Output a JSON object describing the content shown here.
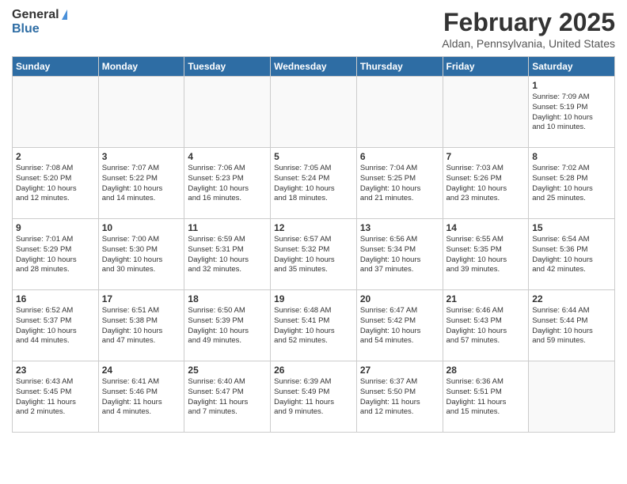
{
  "header": {
    "logo_general": "General",
    "logo_blue": "Blue",
    "title": "February 2025",
    "subtitle": "Aldan, Pennsylvania, United States"
  },
  "weekdays": [
    "Sunday",
    "Monday",
    "Tuesday",
    "Wednesday",
    "Thursday",
    "Friday",
    "Saturday"
  ],
  "weeks": [
    [
      {
        "day": "",
        "info": ""
      },
      {
        "day": "",
        "info": ""
      },
      {
        "day": "",
        "info": ""
      },
      {
        "day": "",
        "info": ""
      },
      {
        "day": "",
        "info": ""
      },
      {
        "day": "",
        "info": ""
      },
      {
        "day": "1",
        "info": "Sunrise: 7:09 AM\nSunset: 5:19 PM\nDaylight: 10 hours\nand 10 minutes."
      }
    ],
    [
      {
        "day": "2",
        "info": "Sunrise: 7:08 AM\nSunset: 5:20 PM\nDaylight: 10 hours\nand 12 minutes."
      },
      {
        "day": "3",
        "info": "Sunrise: 7:07 AM\nSunset: 5:22 PM\nDaylight: 10 hours\nand 14 minutes."
      },
      {
        "day": "4",
        "info": "Sunrise: 7:06 AM\nSunset: 5:23 PM\nDaylight: 10 hours\nand 16 minutes."
      },
      {
        "day": "5",
        "info": "Sunrise: 7:05 AM\nSunset: 5:24 PM\nDaylight: 10 hours\nand 18 minutes."
      },
      {
        "day": "6",
        "info": "Sunrise: 7:04 AM\nSunset: 5:25 PM\nDaylight: 10 hours\nand 21 minutes."
      },
      {
        "day": "7",
        "info": "Sunrise: 7:03 AM\nSunset: 5:26 PM\nDaylight: 10 hours\nand 23 minutes."
      },
      {
        "day": "8",
        "info": "Sunrise: 7:02 AM\nSunset: 5:28 PM\nDaylight: 10 hours\nand 25 minutes."
      }
    ],
    [
      {
        "day": "9",
        "info": "Sunrise: 7:01 AM\nSunset: 5:29 PM\nDaylight: 10 hours\nand 28 minutes."
      },
      {
        "day": "10",
        "info": "Sunrise: 7:00 AM\nSunset: 5:30 PM\nDaylight: 10 hours\nand 30 minutes."
      },
      {
        "day": "11",
        "info": "Sunrise: 6:59 AM\nSunset: 5:31 PM\nDaylight: 10 hours\nand 32 minutes."
      },
      {
        "day": "12",
        "info": "Sunrise: 6:57 AM\nSunset: 5:32 PM\nDaylight: 10 hours\nand 35 minutes."
      },
      {
        "day": "13",
        "info": "Sunrise: 6:56 AM\nSunset: 5:34 PM\nDaylight: 10 hours\nand 37 minutes."
      },
      {
        "day": "14",
        "info": "Sunrise: 6:55 AM\nSunset: 5:35 PM\nDaylight: 10 hours\nand 39 minutes."
      },
      {
        "day": "15",
        "info": "Sunrise: 6:54 AM\nSunset: 5:36 PM\nDaylight: 10 hours\nand 42 minutes."
      }
    ],
    [
      {
        "day": "16",
        "info": "Sunrise: 6:52 AM\nSunset: 5:37 PM\nDaylight: 10 hours\nand 44 minutes."
      },
      {
        "day": "17",
        "info": "Sunrise: 6:51 AM\nSunset: 5:38 PM\nDaylight: 10 hours\nand 47 minutes."
      },
      {
        "day": "18",
        "info": "Sunrise: 6:50 AM\nSunset: 5:39 PM\nDaylight: 10 hours\nand 49 minutes."
      },
      {
        "day": "19",
        "info": "Sunrise: 6:48 AM\nSunset: 5:41 PM\nDaylight: 10 hours\nand 52 minutes."
      },
      {
        "day": "20",
        "info": "Sunrise: 6:47 AM\nSunset: 5:42 PM\nDaylight: 10 hours\nand 54 minutes."
      },
      {
        "day": "21",
        "info": "Sunrise: 6:46 AM\nSunset: 5:43 PM\nDaylight: 10 hours\nand 57 minutes."
      },
      {
        "day": "22",
        "info": "Sunrise: 6:44 AM\nSunset: 5:44 PM\nDaylight: 10 hours\nand 59 minutes."
      }
    ],
    [
      {
        "day": "23",
        "info": "Sunrise: 6:43 AM\nSunset: 5:45 PM\nDaylight: 11 hours\nand 2 minutes."
      },
      {
        "day": "24",
        "info": "Sunrise: 6:41 AM\nSunset: 5:46 PM\nDaylight: 11 hours\nand 4 minutes."
      },
      {
        "day": "25",
        "info": "Sunrise: 6:40 AM\nSunset: 5:47 PM\nDaylight: 11 hours\nand 7 minutes."
      },
      {
        "day": "26",
        "info": "Sunrise: 6:39 AM\nSunset: 5:49 PM\nDaylight: 11 hours\nand 9 minutes."
      },
      {
        "day": "27",
        "info": "Sunrise: 6:37 AM\nSunset: 5:50 PM\nDaylight: 11 hours\nand 12 minutes."
      },
      {
        "day": "28",
        "info": "Sunrise: 6:36 AM\nSunset: 5:51 PM\nDaylight: 11 hours\nand 15 minutes."
      },
      {
        "day": "",
        "info": ""
      }
    ]
  ]
}
